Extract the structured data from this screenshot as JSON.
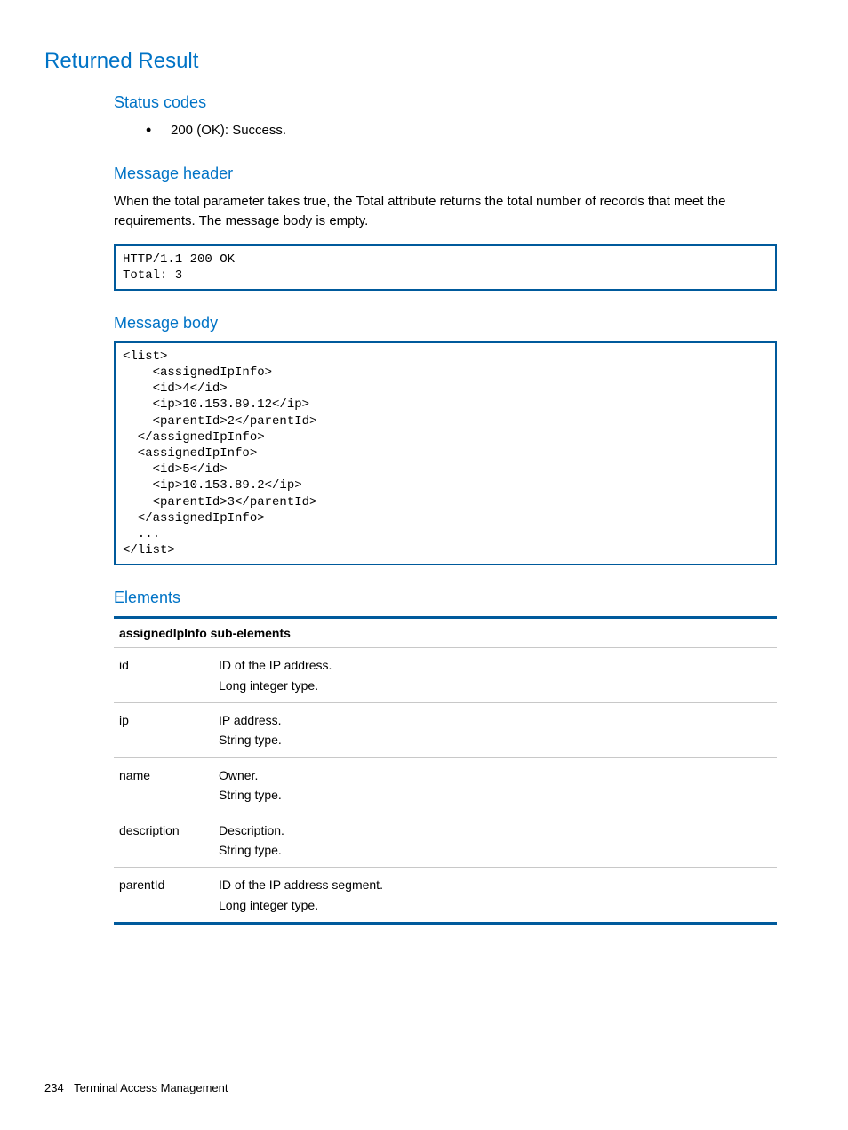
{
  "headings": {
    "main": "Returned Result",
    "statusCodes": "Status codes",
    "messageHeader": "Message header",
    "messageBody": "Message body",
    "elements": "Elements"
  },
  "statusCodes": {
    "item1": "200 (OK): Success."
  },
  "messageHeader": {
    "para": "When the total parameter takes true, the Total attribute returns the total number of records that meet the requirements. The message body is empty.",
    "code": "HTTP/1.1 200 OK\nTotal: 3"
  },
  "messageBody": {
    "code": "<list>\n    <assignedIpInfo>\n    <id>4</id>\n    <ip>10.153.89.12</ip>\n    <parentId>2</parentId>\n  </assignedIpInfo>\n  <assignedIpInfo>\n    <id>5</id>\n    <ip>10.153.89.2</ip>\n    <parentId>3</parentId>\n  </assignedIpInfo>\n  ...\n</list>"
  },
  "elementsTable": {
    "header": "assignedIpInfo sub-elements",
    "rows": [
      {
        "name": "id",
        "desc": "ID of the IP address.\nLong integer type."
      },
      {
        "name": "ip",
        "desc": "IP address.\nString type."
      },
      {
        "name": "name",
        "desc": "Owner.\nString type."
      },
      {
        "name": "description",
        "desc": "Description.\nString type."
      },
      {
        "name": "parentId",
        "desc": "ID of the IP address segment.\nLong integer type."
      }
    ]
  },
  "footer": {
    "page": "234",
    "section": "Terminal Access Management"
  }
}
